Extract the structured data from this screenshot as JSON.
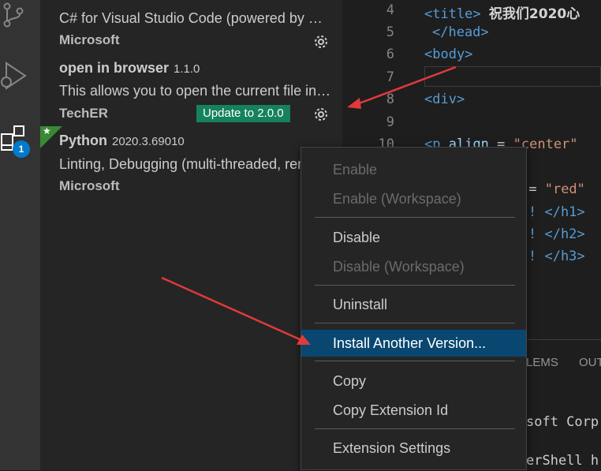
{
  "activity_bar": {
    "icons": [
      "source-control-icon",
      "run-debug-icon",
      "extensions-icon"
    ],
    "extensions_badge": "1"
  },
  "extensions": [
    {
      "name": "C#",
      "version": "",
      "description": "C# for Visual Studio Code (powered by OmniSharp).",
      "publisher": "Microsoft",
      "update_label": ""
    },
    {
      "name": "open in browser",
      "version": "1.1.0",
      "description": "This allows you to open the current file in your default browser.",
      "publisher": "TechER",
      "update_label": "Update to 2.0.0"
    },
    {
      "name": "Python",
      "version": "2020.3.69010",
      "description": "Linting, Debugging (multi-threaded, remote), Intellisense",
      "publisher": "Microsoft",
      "update_label": ""
    }
  ],
  "editor": {
    "line_numbers": [
      "4",
      "5",
      "6",
      "7",
      "8",
      "9",
      "10"
    ],
    "title_text": "祝我们2020心",
    "lines": {
      "l4_open": "<title>",
      "l5": "</head>",
      "l6": "<body>",
      "l8": "<div>",
      "l10_tag": "<p",
      "l10_attr": "align",
      "l10_eq": " = ",
      "l10_val": "\"center\"",
      "l11_eq": " = ",
      "l11_val": "\"red\"",
      "l12": "! </h1>",
      "l13": "! </h2>",
      "l14": "! </h3>"
    }
  },
  "panel": {
    "tabs": [
      "LEMS",
      "OUT"
    ],
    "terminal_lines": [
      "soft Corp",
      "erShell h"
    ]
  },
  "context_menu": {
    "items": [
      {
        "label": "Enable",
        "enabled": false
      },
      {
        "label": "Enable (Workspace)",
        "enabled": false
      },
      {
        "label": "Disable",
        "enabled": true
      },
      {
        "label": "Disable (Workspace)",
        "enabled": false
      },
      {
        "label": "Uninstall",
        "enabled": true
      },
      {
        "label": "Install Another Version...",
        "enabled": true,
        "highlighted": true
      },
      {
        "label": "Copy",
        "enabled": true
      },
      {
        "label": "Copy Extension Id",
        "enabled": true
      },
      {
        "label": "Extension Settings",
        "enabled": true
      }
    ]
  },
  "colors": {
    "accent": "#007acc",
    "update_button": "#16825d",
    "menu_highlight": "#094771",
    "annotation_arrow": "#e03a3a"
  }
}
